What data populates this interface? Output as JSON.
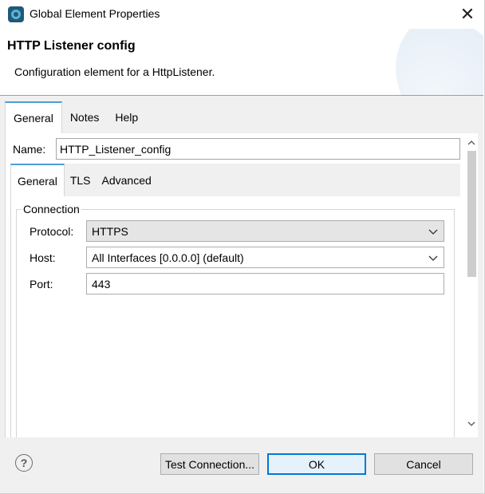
{
  "window": {
    "title": "Global Element Properties",
    "close_glyph": "✕"
  },
  "header": {
    "title": "HTTP Listener config",
    "description": "Configuration element for a HttpListener."
  },
  "outer_tabs": [
    {
      "label": "General",
      "active": true
    },
    {
      "label": "Notes",
      "active": false
    },
    {
      "label": "Help",
      "active": false
    }
  ],
  "name_field": {
    "label": "Name:",
    "value": "HTTP_Listener_config"
  },
  "inner_tabs": [
    {
      "label": "General",
      "active": true
    },
    {
      "label": "TLS",
      "active": false
    },
    {
      "label": "Advanced",
      "active": false
    }
  ],
  "connection": {
    "legend": "Connection",
    "protocol": {
      "label": "Protocol:",
      "value": "HTTPS"
    },
    "host": {
      "label": "Host:",
      "value": "All Interfaces [0.0.0.0] (default)"
    },
    "port": {
      "label": "Port:",
      "value": "443"
    }
  },
  "footer": {
    "help_glyph": "?",
    "test_connection_label": "Test Connection...",
    "ok_label": "OK",
    "cancel_label": "Cancel"
  },
  "scrollbar": {
    "up_glyph": "▲",
    "down_glyph": "▼"
  },
  "colors": {
    "accent": "#4a9edb",
    "default_button_border": "#0078d7",
    "panel_background": "#f0f0f0"
  },
  "icons": {
    "app": "mule-app-icon",
    "close": "close-icon",
    "help": "help-icon",
    "chevron": "chevron-down-icon"
  }
}
